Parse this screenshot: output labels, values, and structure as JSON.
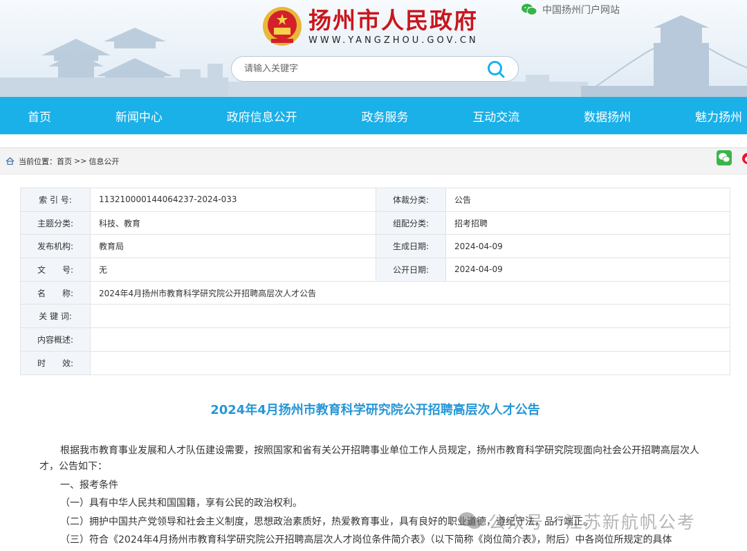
{
  "header": {
    "site_title": "扬州市人民政府",
    "site_url": "WWW.YANGZHOU.GOV.CN",
    "portal_link": "中国扬州门户网站",
    "search_placeholder": "请输入关键字"
  },
  "nav": [
    "首页",
    "新闻中心",
    "政府信息公开",
    "政务服务",
    "互动交流",
    "数据扬州",
    "魅力扬州"
  ],
  "breadcrumb": {
    "prefix": "当前位置：",
    "home": "首页",
    "sep": ">>",
    "current": "信息公开"
  },
  "info": {
    "index_label": "索 引 号:",
    "index_value": "113210000144064237-2024-033",
    "genre_label": "体裁分类:",
    "genre_value": "公告",
    "topic_label": "主题分类:",
    "topic_value": "科技、教育",
    "group_label": "组配分类:",
    "group_value": "招考招聘",
    "publisher_label": "发布机构:",
    "publisher_value": "教育局",
    "created_label": "生成日期:",
    "created_value": "2024-04-09",
    "doc_label": "文　　号:",
    "doc_value": "无",
    "public_label": "公开日期:",
    "public_value": "2024-04-09",
    "name_label": "名　　称:",
    "name_value": "2024年4月扬州市教育科学研究院公开招聘高层次人才公告",
    "keywords_label": "关 键 词:",
    "keywords_value": "",
    "summary_label": "内容概述:",
    "summary_value": "",
    "validity_label": "时　　效:",
    "validity_value": ""
  },
  "article": {
    "title": "2024年4月扬州市教育科学研究院公开招聘高层次人才公告",
    "p1": "根据我市教育事业发展和人才队伍建设需要，按照国家和省有关公开招聘事业单位工作人员规定，扬州市教育科学研究院现面向社会公开招聘高层次人才，公告如下：",
    "p2": "一、报考条件",
    "p3": "（一）具有中华人民共和国国籍，享有公民的政治权利。",
    "p4": "（二）拥护中国共产党领导和社会主义制度，思想政治素质好，热爱教育事业，具有良好的职业道德，遵纪守法，品行端正。",
    "p5": "（三）符合《2024年4月扬州市教育科学研究院公开招聘高层次人才岗位条件简介表》（以下简称《岗位简介表》，附后）中各岗位所规定的具体"
  },
  "watermark": "公众号 · 江苏新航帆公考",
  "colors": {
    "nav": "#1ab0e8",
    "title": "#2596d8",
    "brand_red": "#c8161d"
  }
}
